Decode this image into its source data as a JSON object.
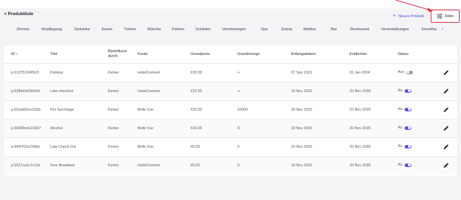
{
  "header": {
    "back_label": "< Produktliste",
    "new_product_label": "Neues Produkt",
    "filter_label": "Filter"
  },
  "categories": [
    "Zimmer",
    "Verpflegung",
    "Getränke",
    "Essen",
    "Tickets",
    "Wäsche",
    "Parken",
    "Schäden",
    "Vermietungen",
    "Spa",
    "Extras",
    "Minibar",
    "Bar",
    "Restaurant",
    "Veranstaltungen",
    "Einzelha"
  ],
  "table": {
    "columns": [
      "ID ↑",
      "Titel",
      "Beeinflusst durch",
      "Konto",
      "Grundpreis",
      "Grundmenge",
      "Anfangsdatum",
      "Endtermin",
      "Status"
    ],
    "rows": [
      {
        "id": "p.613751049523",
        "title": "Parking",
        "affected": "Keiner",
        "account": "HotelConnect",
        "price": "€20.00",
        "qty": "∞",
        "start": "07 Sep 2021",
        "end": "31 Jan 2024",
        "status": "Aus",
        "on": false
      },
      {
        "id": "p.62fbb0e630e09",
        "title": "Late checkout",
        "affected": "Keiner",
        "account": "HotelConnect",
        "price": "€10.00",
        "qty": "∞",
        "start": "19 Nov 2025",
        "end": "20 Nov 2035",
        "status": "An",
        "on": true
      },
      {
        "id": "p.63cad92ce315b",
        "title": "Pet Surcharge",
        "affected": "Keiner",
        "account": "Belle Vue",
        "price": "€20.00",
        "qty": "10000",
        "start": "19 Nov 2025",
        "end": "20 Nov 2035",
        "status": "An",
        "on": true
      },
      {
        "id": "p.64009ed131837",
        "title": "Alcohol",
        "affected": "Keiner",
        "account": "Belle Vue",
        "price": "€10.00",
        "qty": "0",
        "start": "19 Nov 2025",
        "end": "20 Nov 2035",
        "status": "An",
        "on": true
      },
      {
        "id": "p.644f702a7596e",
        "title": "Late Check Out",
        "affected": "Keiner",
        "account": "Belle Vue",
        "price": "€0.00",
        "qty": "0",
        "start": "19 Nov 2025",
        "end": "20 Nov 2035",
        "status": "An",
        "on": true
      },
      {
        "id": "p.6527ca3c1c13e",
        "title": "Free Breakfast",
        "affected": "Keiner",
        "account": "HotelConnect",
        "price": "€0.00",
        "qty": "0",
        "start": "19 Nov 2025",
        "end": "20 Nov 2035",
        "status": "An",
        "on": true
      }
    ]
  },
  "colors": {
    "accent": "#5b4ef0",
    "highlight": "#d6243a"
  }
}
